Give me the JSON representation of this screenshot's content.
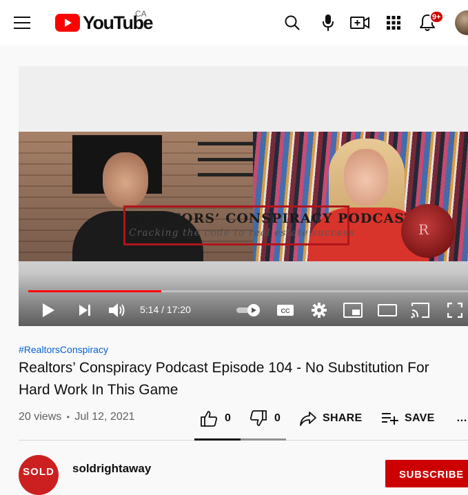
{
  "header": {
    "logo_text": "YouTube",
    "region": "CA",
    "notification_count": "9+",
    "icons": [
      "menu-icon",
      "youtube-logo-icon",
      "search-icon",
      "microphone-icon",
      "create-video-icon",
      "apps-grid-icon",
      "bell-icon",
      "account-avatar"
    ]
  },
  "player": {
    "overlay_title": "REALTORS’ CONSPIRACY PODCAST",
    "overlay_subtitle": "Cracking the code to real estate success",
    "current_time": "5:14",
    "duration": "17:20",
    "time_display": "5:14 / 17:20",
    "progress_fraction": 0.302,
    "controls": [
      "play-icon",
      "next-icon",
      "volume-icon",
      "autoplay-toggle",
      "captions-icon",
      "settings-gear-icon",
      "miniplayer-icon",
      "theater-mode-icon",
      "cast-icon",
      "fullscreen-icon"
    ],
    "captions_label": "CC"
  },
  "video": {
    "hashtag": "#RealtorsConspiracy",
    "title": "Realtors’ Conspiracy Podcast Episode 104 - No Substitution For Hard Work In This Game",
    "views": "20 views",
    "separator": "•",
    "date": "Jul 12, 2021",
    "likes": "0",
    "dislikes": "0",
    "share_label": "SHARE",
    "save_label": "SAVE",
    "more_label": "…",
    "like_fraction": 0.5
  },
  "channel": {
    "avatar_text": "SOLD",
    "name": "soldrightaway",
    "subscribe_label": "SUBSCRIBE"
  },
  "colors": {
    "accent_red": "#ff0000",
    "subscribe_red": "#cc0000",
    "link_blue": "#065fd4"
  }
}
